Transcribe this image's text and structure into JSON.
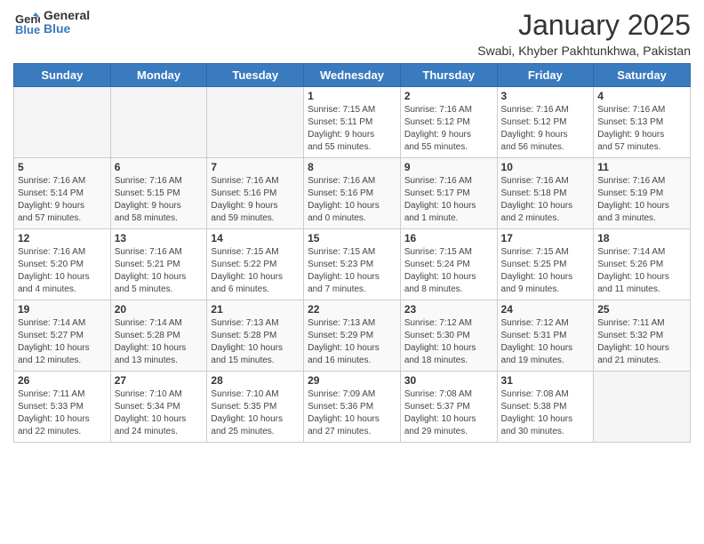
{
  "header": {
    "logo_line1": "General",
    "logo_line2": "Blue",
    "month_title": "January 2025",
    "location": "Swabi, Khyber Pakhtunkhwa, Pakistan"
  },
  "weekdays": [
    "Sunday",
    "Monday",
    "Tuesday",
    "Wednesday",
    "Thursday",
    "Friday",
    "Saturday"
  ],
  "weeks": [
    [
      {
        "day": "",
        "info": ""
      },
      {
        "day": "",
        "info": ""
      },
      {
        "day": "",
        "info": ""
      },
      {
        "day": "1",
        "info": "Sunrise: 7:15 AM\nSunset: 5:11 PM\nDaylight: 9 hours\nand 55 minutes."
      },
      {
        "day": "2",
        "info": "Sunrise: 7:16 AM\nSunset: 5:12 PM\nDaylight: 9 hours\nand 55 minutes."
      },
      {
        "day": "3",
        "info": "Sunrise: 7:16 AM\nSunset: 5:12 PM\nDaylight: 9 hours\nand 56 minutes."
      },
      {
        "day": "4",
        "info": "Sunrise: 7:16 AM\nSunset: 5:13 PM\nDaylight: 9 hours\nand 57 minutes."
      }
    ],
    [
      {
        "day": "5",
        "info": "Sunrise: 7:16 AM\nSunset: 5:14 PM\nDaylight: 9 hours\nand 57 minutes."
      },
      {
        "day": "6",
        "info": "Sunrise: 7:16 AM\nSunset: 5:15 PM\nDaylight: 9 hours\nand 58 minutes."
      },
      {
        "day": "7",
        "info": "Sunrise: 7:16 AM\nSunset: 5:16 PM\nDaylight: 9 hours\nand 59 minutes."
      },
      {
        "day": "8",
        "info": "Sunrise: 7:16 AM\nSunset: 5:16 PM\nDaylight: 10 hours\nand 0 minutes."
      },
      {
        "day": "9",
        "info": "Sunrise: 7:16 AM\nSunset: 5:17 PM\nDaylight: 10 hours\nand 1 minute."
      },
      {
        "day": "10",
        "info": "Sunrise: 7:16 AM\nSunset: 5:18 PM\nDaylight: 10 hours\nand 2 minutes."
      },
      {
        "day": "11",
        "info": "Sunrise: 7:16 AM\nSunset: 5:19 PM\nDaylight: 10 hours\nand 3 minutes."
      }
    ],
    [
      {
        "day": "12",
        "info": "Sunrise: 7:16 AM\nSunset: 5:20 PM\nDaylight: 10 hours\nand 4 minutes."
      },
      {
        "day": "13",
        "info": "Sunrise: 7:16 AM\nSunset: 5:21 PM\nDaylight: 10 hours\nand 5 minutes."
      },
      {
        "day": "14",
        "info": "Sunrise: 7:15 AM\nSunset: 5:22 PM\nDaylight: 10 hours\nand 6 minutes."
      },
      {
        "day": "15",
        "info": "Sunrise: 7:15 AM\nSunset: 5:23 PM\nDaylight: 10 hours\nand 7 minutes."
      },
      {
        "day": "16",
        "info": "Sunrise: 7:15 AM\nSunset: 5:24 PM\nDaylight: 10 hours\nand 8 minutes."
      },
      {
        "day": "17",
        "info": "Sunrise: 7:15 AM\nSunset: 5:25 PM\nDaylight: 10 hours\nand 9 minutes."
      },
      {
        "day": "18",
        "info": "Sunrise: 7:14 AM\nSunset: 5:26 PM\nDaylight: 10 hours\nand 11 minutes."
      }
    ],
    [
      {
        "day": "19",
        "info": "Sunrise: 7:14 AM\nSunset: 5:27 PM\nDaylight: 10 hours\nand 12 minutes."
      },
      {
        "day": "20",
        "info": "Sunrise: 7:14 AM\nSunset: 5:28 PM\nDaylight: 10 hours\nand 13 minutes."
      },
      {
        "day": "21",
        "info": "Sunrise: 7:13 AM\nSunset: 5:28 PM\nDaylight: 10 hours\nand 15 minutes."
      },
      {
        "day": "22",
        "info": "Sunrise: 7:13 AM\nSunset: 5:29 PM\nDaylight: 10 hours\nand 16 minutes."
      },
      {
        "day": "23",
        "info": "Sunrise: 7:12 AM\nSunset: 5:30 PM\nDaylight: 10 hours\nand 18 minutes."
      },
      {
        "day": "24",
        "info": "Sunrise: 7:12 AM\nSunset: 5:31 PM\nDaylight: 10 hours\nand 19 minutes."
      },
      {
        "day": "25",
        "info": "Sunrise: 7:11 AM\nSunset: 5:32 PM\nDaylight: 10 hours\nand 21 minutes."
      }
    ],
    [
      {
        "day": "26",
        "info": "Sunrise: 7:11 AM\nSunset: 5:33 PM\nDaylight: 10 hours\nand 22 minutes."
      },
      {
        "day": "27",
        "info": "Sunrise: 7:10 AM\nSunset: 5:34 PM\nDaylight: 10 hours\nand 24 minutes."
      },
      {
        "day": "28",
        "info": "Sunrise: 7:10 AM\nSunset: 5:35 PM\nDaylight: 10 hours\nand 25 minutes."
      },
      {
        "day": "29",
        "info": "Sunrise: 7:09 AM\nSunset: 5:36 PM\nDaylight: 10 hours\nand 27 minutes."
      },
      {
        "day": "30",
        "info": "Sunrise: 7:08 AM\nSunset: 5:37 PM\nDaylight: 10 hours\nand 29 minutes."
      },
      {
        "day": "31",
        "info": "Sunrise: 7:08 AM\nSunset: 5:38 PM\nDaylight: 10 hours\nand 30 minutes."
      },
      {
        "day": "",
        "info": ""
      }
    ]
  ]
}
